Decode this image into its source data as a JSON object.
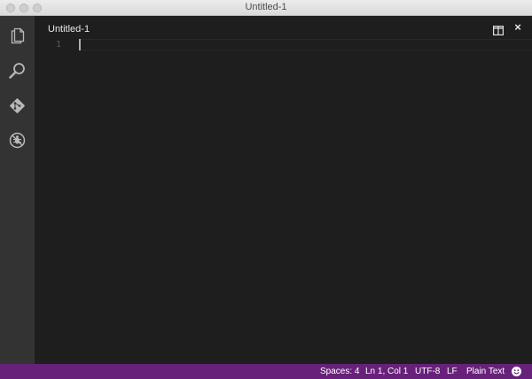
{
  "window": {
    "title": "Untitled-1"
  },
  "activity_bar": {
    "items": [
      {
        "icon": "explorer-icon"
      },
      {
        "icon": "search-icon"
      },
      {
        "icon": "git-icon"
      },
      {
        "icon": "debug-icon"
      }
    ]
  },
  "editor": {
    "tab_title": "Untitled-1",
    "split_icon": "split-editor-icon",
    "close_icon": "close-icon",
    "close_glyph": "×",
    "lines": [
      {
        "number": "1",
        "text": ""
      }
    ]
  },
  "status_bar": {
    "background": "#68217a",
    "spaces": "Spaces: 4",
    "position": "Ln 1, Col 1",
    "encoding": "UTF-8",
    "eol": "LF",
    "language": "Plain Text",
    "feedback_icon": "smiley-icon"
  }
}
